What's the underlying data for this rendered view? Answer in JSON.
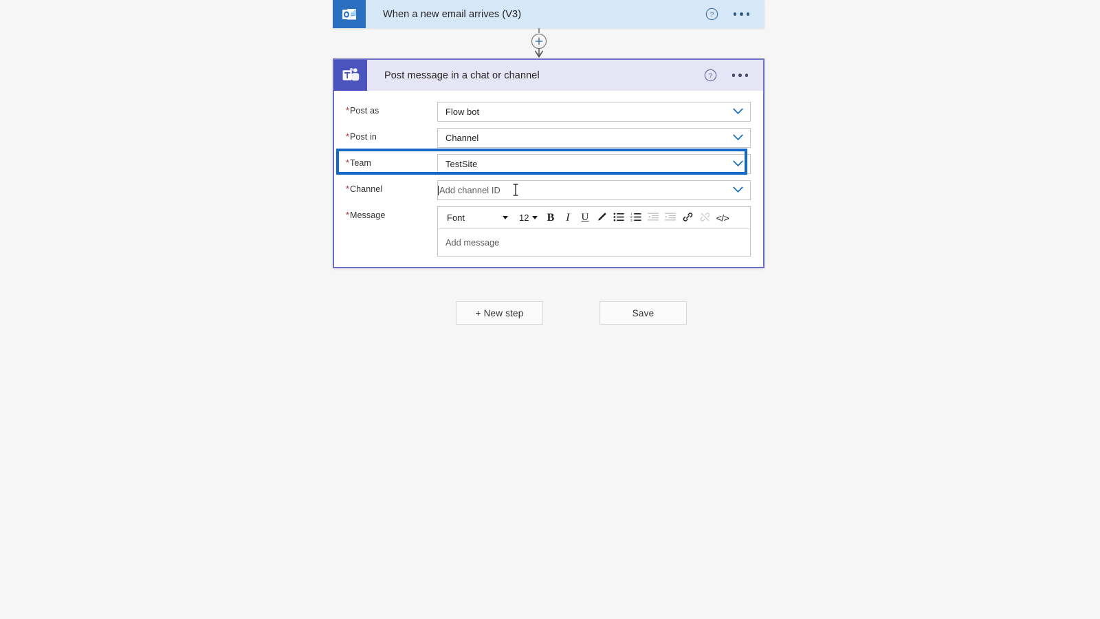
{
  "flow": {
    "trigger": {
      "title": "When a new email arrives (V3)",
      "icon": "outlook-icon",
      "help_icon": "help-circle-icon",
      "more_icon": "more-options-icon",
      "header_bg": "#d6e7f7",
      "icon_bg": "#2b6fc0"
    },
    "connector": {
      "icon": "insert-step-plus-icon",
      "arrow_icon": "arrow-down-icon"
    },
    "action": {
      "title": "Post message in a chat or channel",
      "icon": "teams-icon",
      "help_icon": "help-circle-icon",
      "more_icon": "more-options-icon",
      "header_bg": "#e6e5f5",
      "icon_bg": "#4b53bc",
      "selected_border": "#6b6fc4",
      "fields": [
        {
          "name": "post-as",
          "label": "Post as",
          "required": true,
          "value": "Flow bot",
          "is_placeholder": false,
          "chevron": "chevron-down-icon"
        },
        {
          "name": "post-in",
          "label": "Post in",
          "required": true,
          "value": "Channel",
          "is_placeholder": false,
          "chevron": "chevron-down-icon"
        },
        {
          "name": "team",
          "label": "Team",
          "required": true,
          "value": "TestSite",
          "is_placeholder": false,
          "chevron": "chevron-down-icon",
          "highlighted": true,
          "highlight_color": "#1567c8"
        },
        {
          "name": "channel",
          "label": "Channel",
          "required": true,
          "value": "Add channel ID",
          "is_placeholder": true,
          "focused": true,
          "chevron": "chevron-down-icon"
        }
      ],
      "message_field": {
        "label": "Message",
        "required": true,
        "placeholder": "Add message",
        "toolbar": {
          "font_label": "Font",
          "size_label": "12",
          "buttons": [
            {
              "name": "bold-button",
              "glyph": "B",
              "disabled": false
            },
            {
              "name": "italic-button",
              "glyph": "I",
              "disabled": false
            },
            {
              "name": "underline-button",
              "glyph": "U",
              "disabled": false
            },
            {
              "name": "font-color-button",
              "glyph": "pen-icon",
              "disabled": false
            },
            {
              "name": "bulleted-list-button",
              "glyph": "bulleted-list-icon",
              "disabled": false
            },
            {
              "name": "numbered-list-button",
              "glyph": "numbered-list-icon",
              "disabled": false
            },
            {
              "name": "decrease-indent-button",
              "glyph": "decrease-indent-icon",
              "disabled": true
            },
            {
              "name": "increase-indent-button",
              "glyph": "increase-indent-icon",
              "disabled": true
            },
            {
              "name": "insert-link-button",
              "glyph": "link-icon",
              "disabled": false
            },
            {
              "name": "remove-link-button",
              "glyph": "unlink-icon",
              "disabled": true
            },
            {
              "name": "code-view-button",
              "glyph": "</>",
              "disabled": false
            }
          ]
        }
      }
    }
  },
  "footer": {
    "new_step_label": "+ New step",
    "save_label": "Save"
  },
  "cursor": {
    "type": "text-ibeam-cursor"
  },
  "colors": {
    "page_background": "#f6f6f6",
    "trigger_header": "#d6e7f7",
    "action_header": "#e6e5f5",
    "accent_blue": "#1567c8",
    "teams_purple": "#4b53bc",
    "outlook_blue": "#2b6fc0",
    "required_star": "#a4262c"
  }
}
